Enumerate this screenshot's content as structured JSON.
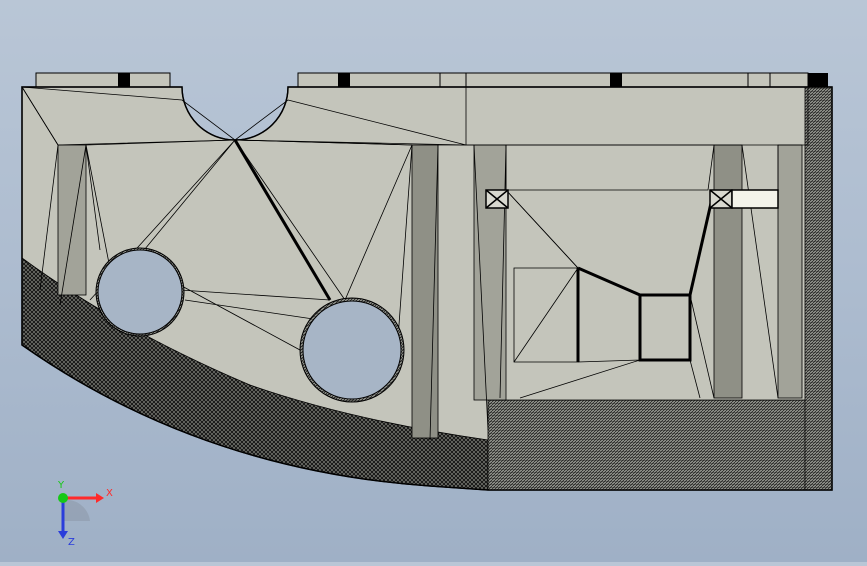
{
  "viewport": {
    "colors": {
      "background_top": "#b9c6d6",
      "background_bottom": "#9fb0c6",
      "part_face": "#c4c5bb",
      "part_shadow": "#8e8f85",
      "mesh_edge": "#000000",
      "hole_fill": "#a7b5c6"
    },
    "icons": [
      "mesh-part-icon"
    ]
  },
  "triad": {
    "x_label": "X",
    "y_label": "Y",
    "z_label": "Z",
    "colors": {
      "x": "#ff2a2a",
      "y": "#16c816",
      "z": "#2a3ddb"
    }
  }
}
